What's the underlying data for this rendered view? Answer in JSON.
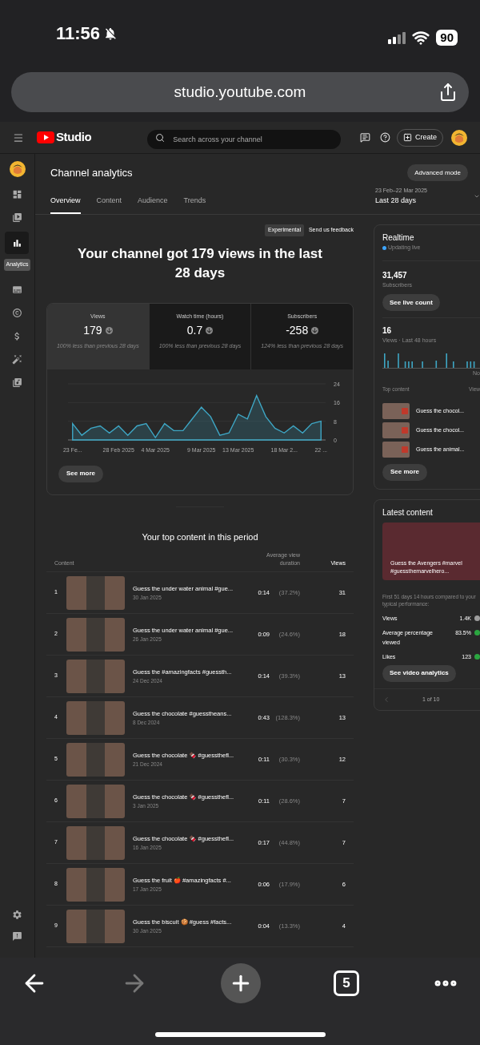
{
  "status_bar": {
    "time": "11:56",
    "battery": "90"
  },
  "browser": {
    "url": "studio.youtube.com",
    "toolbar": [
      {
        "kind": "back",
        "disabled": false
      },
      {
        "kind": "forward",
        "disabled": true
      },
      {
        "kind": "new_tab",
        "disabled": false
      },
      {
        "kind": "tabs",
        "count": "5",
        "disabled": false
      },
      {
        "kind": "more",
        "disabled": false
      }
    ]
  },
  "header": {
    "logo": "Studio",
    "search": {
      "placeholder": "Search across your channel"
    },
    "create_button": "Create"
  },
  "sidebar": {
    "items": [
      {
        "kind": "dashboard",
        "selected": false
      },
      {
        "kind": "content",
        "selected": false
      },
      {
        "kind": "analytics",
        "selected": true,
        "tooltip": "Analytics"
      },
      {
        "kind": "subtitles",
        "selected": false
      },
      {
        "kind": "copyright",
        "selected": false
      },
      {
        "kind": "earn",
        "selected": false
      },
      {
        "kind": "customisation",
        "selected": false
      },
      {
        "kind": "audio",
        "selected": false
      }
    ],
    "bottom_items": [
      {
        "kind": "settings"
      },
      {
        "kind": "feedback"
      }
    ]
  },
  "page": {
    "title": "Channel analytics",
    "advanced_button": "Advanced mode",
    "tabs": [
      {
        "label": "Overview",
        "selected": true
      },
      {
        "label": "Content",
        "selected": false
      },
      {
        "label": "Audience",
        "selected": false
      },
      {
        "label": "Trends",
        "selected": false
      }
    ],
    "date_range": {
      "range": "23 Feb–22 Mar 2025",
      "label": "Last 28 days"
    }
  },
  "overview": {
    "badge": "Experimental",
    "feedback_link": "Send us feedback",
    "headline": "Your channel got 179 views in the last 28 days",
    "metrics": [
      {
        "label": "Views",
        "value": "179",
        "change": "100% less than previous 28 days",
        "selected": true
      },
      {
        "label": "Watch time (hours)",
        "value": "0.7",
        "change": "100% less than previous 28 days",
        "selected": false
      },
      {
        "label": "Subscribers",
        "value": "-258",
        "change": "124% less than previous 28 days",
        "selected": false
      }
    ],
    "chart_data": {
      "type": "area",
      "categories": [
        "23 Fe...",
        null,
        null,
        null,
        null,
        "28 Feb 2025",
        null,
        null,
        null,
        "4 Mar 2025",
        null,
        null,
        null,
        null,
        "9 Mar 2025",
        null,
        null,
        null,
        "13 Mar 2025",
        null,
        null,
        null,
        null,
        "18 Mar 2...",
        null,
        null,
        null,
        "22 ..."
      ],
      "series": [
        {
          "color": "#3ea6c4",
          "values": [
            7,
            2,
            5,
            6,
            3,
            6,
            2,
            6,
            7,
            1,
            7,
            4,
            4,
            9,
            14,
            10,
            2,
            3,
            11,
            9,
            19,
            10,
            5,
            3,
            6,
            3,
            7,
            8
          ]
        }
      ],
      "ylim": [
        0,
        24
      ],
      "yticks": [
        0,
        8,
        16,
        24
      ]
    },
    "see_more": "See more"
  },
  "top_content": {
    "title": "Your top content in this period",
    "columns": [
      "Content",
      "Average view duration",
      "Views"
    ],
    "rows": [
      {
        "rank": "1",
        "title": "Guess the under water animal #gue...",
        "date": "30 Jan 2025",
        "duration": "0:14",
        "percent": "(37.2%)",
        "views": "31"
      },
      {
        "rank": "2",
        "title": "Guess the under water animal #gue...",
        "date": "26 Jan 2025",
        "duration": "0:09",
        "percent": "(24.6%)",
        "views": "18"
      },
      {
        "rank": "3",
        "title": "Guess the #amazingfacts #guessth...",
        "date": "24 Dec 2024",
        "duration": "0:14",
        "percent": "(39.3%)",
        "views": "13"
      },
      {
        "rank": "4",
        "title": "Guess the chocolate #guesstheans...",
        "date": "8 Dec 2024",
        "duration": "0:43",
        "percent": "(128.3%)",
        "views": "13"
      },
      {
        "rank": "5",
        "title": "Guess the chocolate 🍫 #guessthefl...",
        "date": "21 Dec 2024",
        "duration": "0:11",
        "percent": "(30.3%)",
        "views": "12"
      },
      {
        "rank": "6",
        "title": "Guess the chocolate 🍫 #guessthefl...",
        "date": "3 Jan 2025",
        "duration": "0:11",
        "percent": "(28.6%)",
        "views": "7"
      },
      {
        "rank": "7",
        "title": "Guess the chocolate 🍫 #guessthefl...",
        "date": "16 Jan 2025",
        "duration": "0:17",
        "percent": "(44.8%)",
        "views": "7"
      },
      {
        "rank": "8",
        "title": "Guess the fruit 🍎 #amazingfacts #...",
        "date": "17 Jan 2025",
        "duration": "0:06",
        "percent": "(17.9%)",
        "views": "6"
      },
      {
        "rank": "9",
        "title": "Guess the biscuit 🍪 #guess #facts...",
        "date": "30 Jan 2025",
        "duration": "0:04",
        "percent": "(13.3%)",
        "views": "4"
      }
    ]
  },
  "realtime": {
    "title": "Realtime",
    "status": "Updating live",
    "subscribers": "31,457",
    "subscribers_label": "Subscribers",
    "live_button": "See live count",
    "views": "16",
    "views_label": "Views · Last 48 hours",
    "axis_label": "No",
    "top_label": "Top content",
    "views_header": "View",
    "items": [
      {
        "title": "Guess the chocol..."
      },
      {
        "title": "Guess the chocol..."
      },
      {
        "title": "Guess the animal..."
      }
    ],
    "see_more": "See more"
  },
  "latest": {
    "title": "Latest content",
    "video_title": "Guess the Avengers #marvel #guessthemarvelhero...",
    "note": "First 51 days 14 hours compared to your typical performance:",
    "metrics": [
      {
        "label": "Views",
        "value": "1.4K",
        "color": "#9e9e9e"
      },
      {
        "label": "Average percentage viewed",
        "value": "83.5%",
        "color": "#2ba640"
      },
      {
        "label": "Likes",
        "value": "123",
        "color": "#2ba640"
      }
    ],
    "button": "See video analytics",
    "pager": "1 of 10",
    "prev_disabled": true
  }
}
